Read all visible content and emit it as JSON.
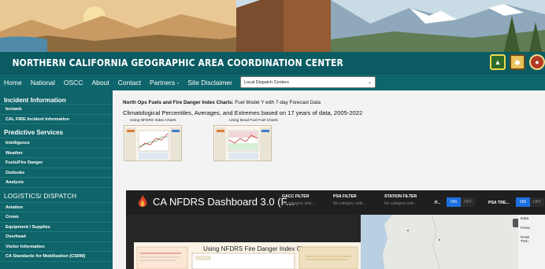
{
  "header": {
    "title": "NORTHERN CALIFORNIA GEOGRAPHIC AREA COORDINATION CENTER",
    "logos": [
      "usfs-shield-icon",
      "blm-badge-icon",
      "calfire-badge-icon"
    ]
  },
  "nav": {
    "items": [
      "Home",
      "National",
      "OSCC",
      "About",
      "Contact",
      "Partners -",
      "Site Disclaimer"
    ],
    "select": {
      "value": "Local Dispatch Centers"
    }
  },
  "sidebar": {
    "incident_heading": "Incident Information",
    "incident_items": [
      "Inciweb",
      "CAL FIRE Incident Information"
    ],
    "predictive_heading": "Predictive Services",
    "predictive_items": [
      "Intelligence",
      "Weather",
      "Fuels/Fire Danger",
      "Outlooks",
      "Analysis"
    ],
    "logistics_heading": "LOGISTICS/ DISPATCH",
    "logistics_items": [
      "Aviation",
      "Crews",
      "Equipment / Supplies",
      "Overhead",
      "Visitor Information",
      "CA Standards for Mobilization (CSRM)"
    ]
  },
  "main": {
    "intro_bold": "North Ops Fuels and Fire Danger Index Charts:",
    "intro_rest": " Fuel Model Y with 7-day Forecast Data",
    "subintro": "Climatological Percentiles, Averages, and Extremes based on 17 years of data, 2005-2022",
    "thumb1_label": "Using NFDRS Index  Charts",
    "thumb2_label": "Using Dead Fuel Fuel Charts"
  },
  "dashboard": {
    "title": "CA NFDRS Dashboard 3.0 (F...",
    "filters": [
      {
        "label": "GACC FILTER",
        "value": "No category sele..."
      },
      {
        "label": "PSA FILTER",
        "value": "No category sele..."
      },
      {
        "label": "STATION FILTER",
        "value": "No category sele..."
      }
    ],
    "toggle1_label": "P...",
    "toggle2_label": "PSA TRE...",
    "on_label": "ON",
    "off_label": "OFF",
    "poster_title": "Using NFDRS Fire Danger Index Charts",
    "side_labels": [
      "Data",
      "Forec",
      "RAW",
      "Tren"
    ]
  },
  "colors": {
    "title_bar": "#0b5b62",
    "nav_bar": "#0e666c",
    "sidebar": "#0f6469",
    "toggle_on": "#1c6fe0"
  }
}
